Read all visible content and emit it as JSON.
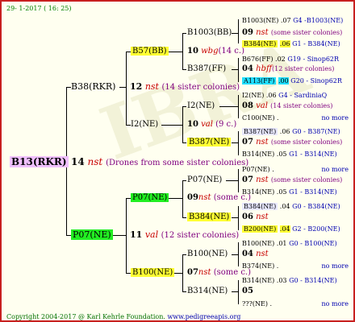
{
  "header": {
    "date": "29-  1-2017  ( 16: 25)"
  },
  "footer": {
    "copyright": "Copyright 2004-2017 @ Karl Kehrle Foundation.",
    "url": "www.pedigreeapis.org"
  },
  "root": {
    "name": "B13(RKR)",
    "num": "14",
    "mark": "nst",
    "note": "(Drones from some sister colonies)"
  },
  "gen1": {
    "top": {
      "name": "B38(RKR)",
      "num": "12",
      "mark": "nst",
      "note": "(14 sister colonies)"
    },
    "bottom": {
      "name": "P07(NE)",
      "num": "11",
      "mark": "val",
      "note": "(12 sister colonies)"
    }
  },
  "gen2": [
    {
      "name": "B57(BB)",
      "num": "10",
      "mark": "wbg",
      "note": "(14 c.)"
    },
    {
      "name": "I2(NE)",
      "num": "10",
      "mark": "val",
      "note": "(9 c.)"
    },
    {
      "name": "P07(NE)",
      "num": "09",
      "mark": "nst",
      "note": "(some c.)"
    },
    {
      "name": "B100(NE)",
      "num": "07",
      "mark": "nst",
      "note": "(some c.)"
    }
  ],
  "gen3": [
    {
      "name": "B1003(BB)",
      "num": "09",
      "mark": "nst",
      "note": "(some sister colonies)"
    },
    {
      "name": "B387(FF)",
      "num": "04",
      "mark": "hbff",
      "note": "(12 sister colonies)"
    },
    {
      "name": "I2(NE)",
      "num": "08",
      "mark": "val",
      "note": "(14 sister colonies)"
    },
    {
      "name": "B387(NE)",
      "num": "07",
      "mark": "nst",
      "note": "(some sister colonies)"
    },
    {
      "name": "P07(NE)",
      "num": "07",
      "mark": "nst",
      "note": "(some sister colonies)"
    },
    {
      "name": "B384(NE)",
      "num": "06",
      "mark": "nst",
      "note": ""
    },
    {
      "name": "B100(NE)",
      "num": "04",
      "mark": "nst",
      "note": ""
    },
    {
      "name": "B314(NE)",
      "num": "05",
      "mark": "",
      "note": ""
    }
  ],
  "gen4": [
    {
      "name": "B1003(NE)",
      "val": ".07",
      "code": "G4 -B1003(NE)"
    },
    {
      "name": "B384(NE)",
      "val": ".06",
      "code": "G1 - B384(NE)"
    },
    {
      "name": "B676(FF)",
      "val": ".02",
      "code": "G19 - Sinop62R"
    },
    {
      "name": "A113(FF)",
      "val": ".00",
      "code": "G20 - Sinop62R"
    },
    {
      "name": "I2(NE)",
      "val": ".06",
      "code": "G4 - SardiniaQ"
    },
    {
      "name": "C100(NE)",
      "val": ".",
      "code": "no more"
    },
    {
      "name": "B387(NE)",
      "val": ".06",
      "code": "G0 - B387(NE)"
    },
    {
      "name": "B314(NE)",
      "val": ".05",
      "code": "G1 - B314(NE)"
    },
    {
      "name": "P07(NE)",
      "val": ".",
      "code": "no more"
    },
    {
      "name": "B314(NE)",
      "val": ".05",
      "code": "G1 - B314(NE)"
    },
    {
      "name": "B384(NE)",
      "val": ".04",
      "code": "G0 - B384(NE)"
    },
    {
      "name": "B200(NE)",
      "val": ".04",
      "code": "G2 - B200(NE)"
    },
    {
      "name": "B100(NE)",
      "val": ".01",
      "code": "G0 - B100(NE)"
    },
    {
      "name": "B374(NE)",
      "val": ".",
      "code": "no more"
    },
    {
      "name": "B314(NE)",
      "val": ".03",
      "code": "G0 - B314(NE)"
    },
    {
      "name": "???(NE)",
      "val": ".",
      "code": "no more"
    }
  ]
}
